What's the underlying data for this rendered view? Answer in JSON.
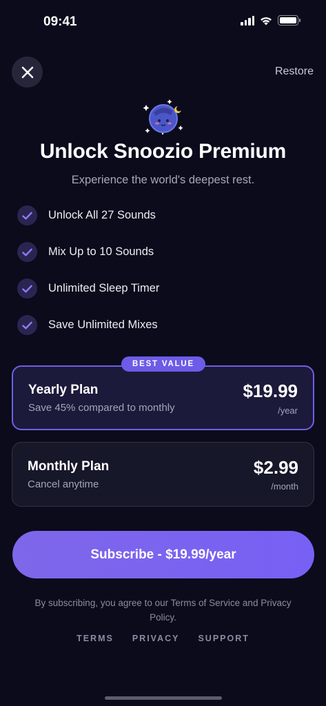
{
  "status_bar": {
    "time": "09:41",
    "icons": [
      "signal-icon",
      "wifi-icon",
      "battery-icon"
    ]
  },
  "header": {
    "close_icon": "close-icon",
    "restore_label": "Restore"
  },
  "hero": {
    "title": "Unlock Snoozio Premium",
    "subtitle": "Experience the world's deepest rest."
  },
  "features": [
    {
      "label": "Unlock All 27 Sounds",
      "icon": "check-icon"
    },
    {
      "label": "Mix Up to 10 Sounds",
      "icon": "check-icon"
    },
    {
      "label": "Unlimited Sleep Timer",
      "icon": "check-icon"
    },
    {
      "label": "Save Unlimited Mixes",
      "icon": "check-icon"
    }
  ],
  "plans": {
    "badge": "BEST VALUE",
    "yearly": {
      "name": "Yearly Plan",
      "description": "Save 45% compared to monthly",
      "price": "$19.99",
      "period": "/year",
      "selected": true
    },
    "monthly": {
      "name": "Monthly Plan",
      "description": "Cancel anytime",
      "price": "$2.99",
      "period": "/month",
      "selected": false
    }
  },
  "cta": {
    "subscribe_label": "Subscribe - $19.99/year"
  },
  "legal": {
    "text": "By subscribing, you agree to our Terms of Service and Privacy Policy."
  },
  "footer": {
    "links": [
      "TERMS",
      "PRIVACY",
      "SUPPORT"
    ]
  },
  "colors": {
    "background": "#0b0b1c",
    "accent": "#6c5ce7",
    "check": "#8f7cff",
    "muted_text": "#a4a4b8"
  }
}
